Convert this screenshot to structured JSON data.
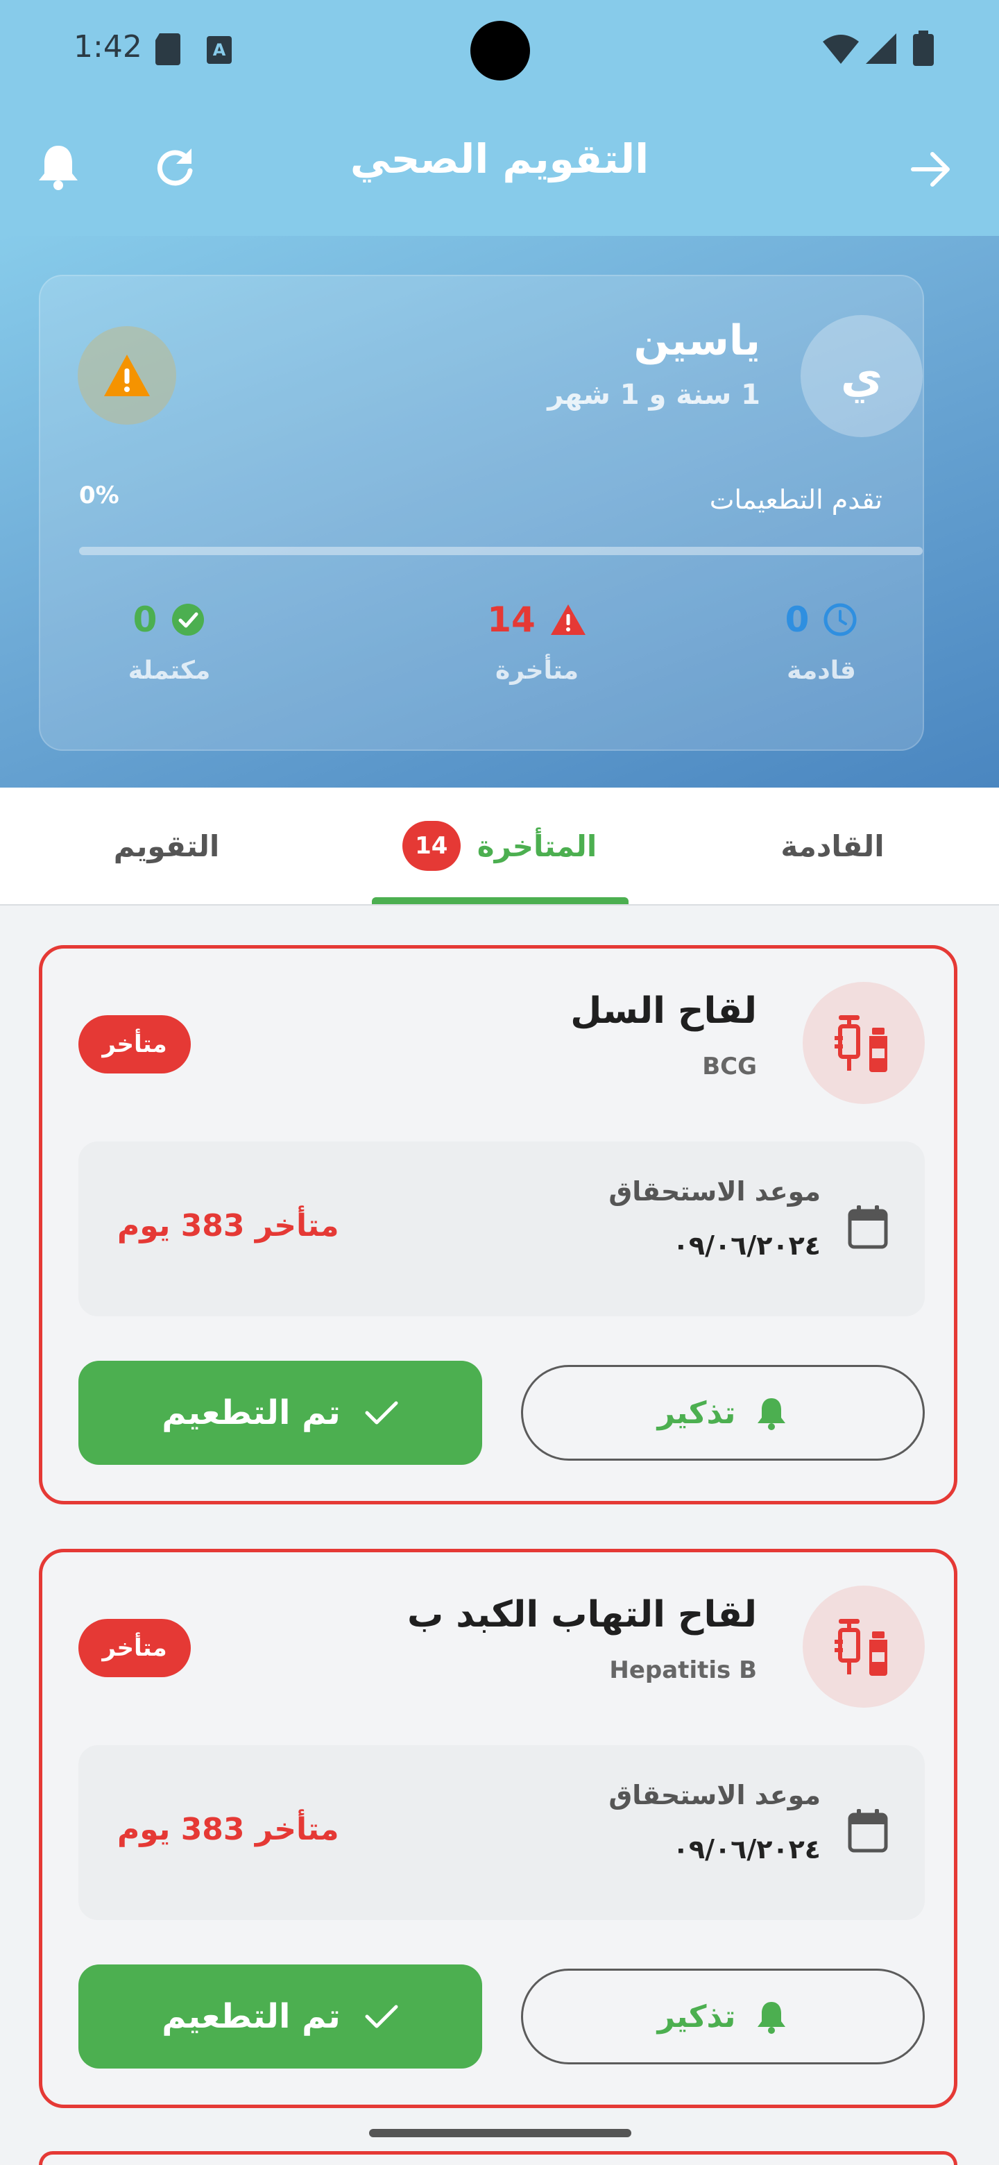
{
  "status_bar": {
    "time": "1:42"
  },
  "app_bar": {
    "title": "التقويم الصحي"
  },
  "profile": {
    "avatar_letter": "ي",
    "name": "ياسين",
    "age": "1 سنة و 1 شهر",
    "progress_label": "تقدم التطعيمات",
    "progress_percent_text": "0%",
    "progress_fraction": 0,
    "stats": {
      "completed": {
        "value": "0",
        "label": "مكتملة"
      },
      "overdue": {
        "value": "14",
        "label": "متأخرة"
      },
      "upcoming": {
        "value": "0",
        "label": "قادمة"
      }
    }
  },
  "tabs": {
    "calendar": "التقويم",
    "overdue": "المتأخرة",
    "overdue_count": "14",
    "upcoming": "القادمة"
  },
  "vaccines": [
    {
      "name": "لقاح السل",
      "code": "BCG",
      "status": "متأخر",
      "due_label": "موعد الاستحقاق",
      "due_date": "٠٩/٠٦/٢٠٢٤",
      "late_text": "متأخر 383 يوم",
      "remind_label": "تذكير",
      "done_label": "تم التطعيم"
    },
    {
      "name": "لقاح التهاب الكبد ب",
      "code": "Hepatitis B",
      "status": "متأخر",
      "due_label": "موعد الاستحقاق",
      "due_date": "٠٩/٠٦/٢٠٢٤",
      "late_text": "متأخر 383 يوم",
      "remind_label": "تذكير",
      "done_label": "تم التطعيم"
    }
  ],
  "colors": {
    "accent_green": "#4caf50",
    "alert_red": "#e53935",
    "header_blue": "#87cbea",
    "warning_orange": "#f59300",
    "upcoming_blue": "#2f8fe0"
  },
  "icons": [
    "bell-icon",
    "refresh-icon",
    "arrow-right-icon",
    "warning-icon",
    "check-circle-icon",
    "warning-triangle-icon",
    "clock-icon",
    "vaccine-icon",
    "calendar-icon",
    "checkmark-icon"
  ]
}
